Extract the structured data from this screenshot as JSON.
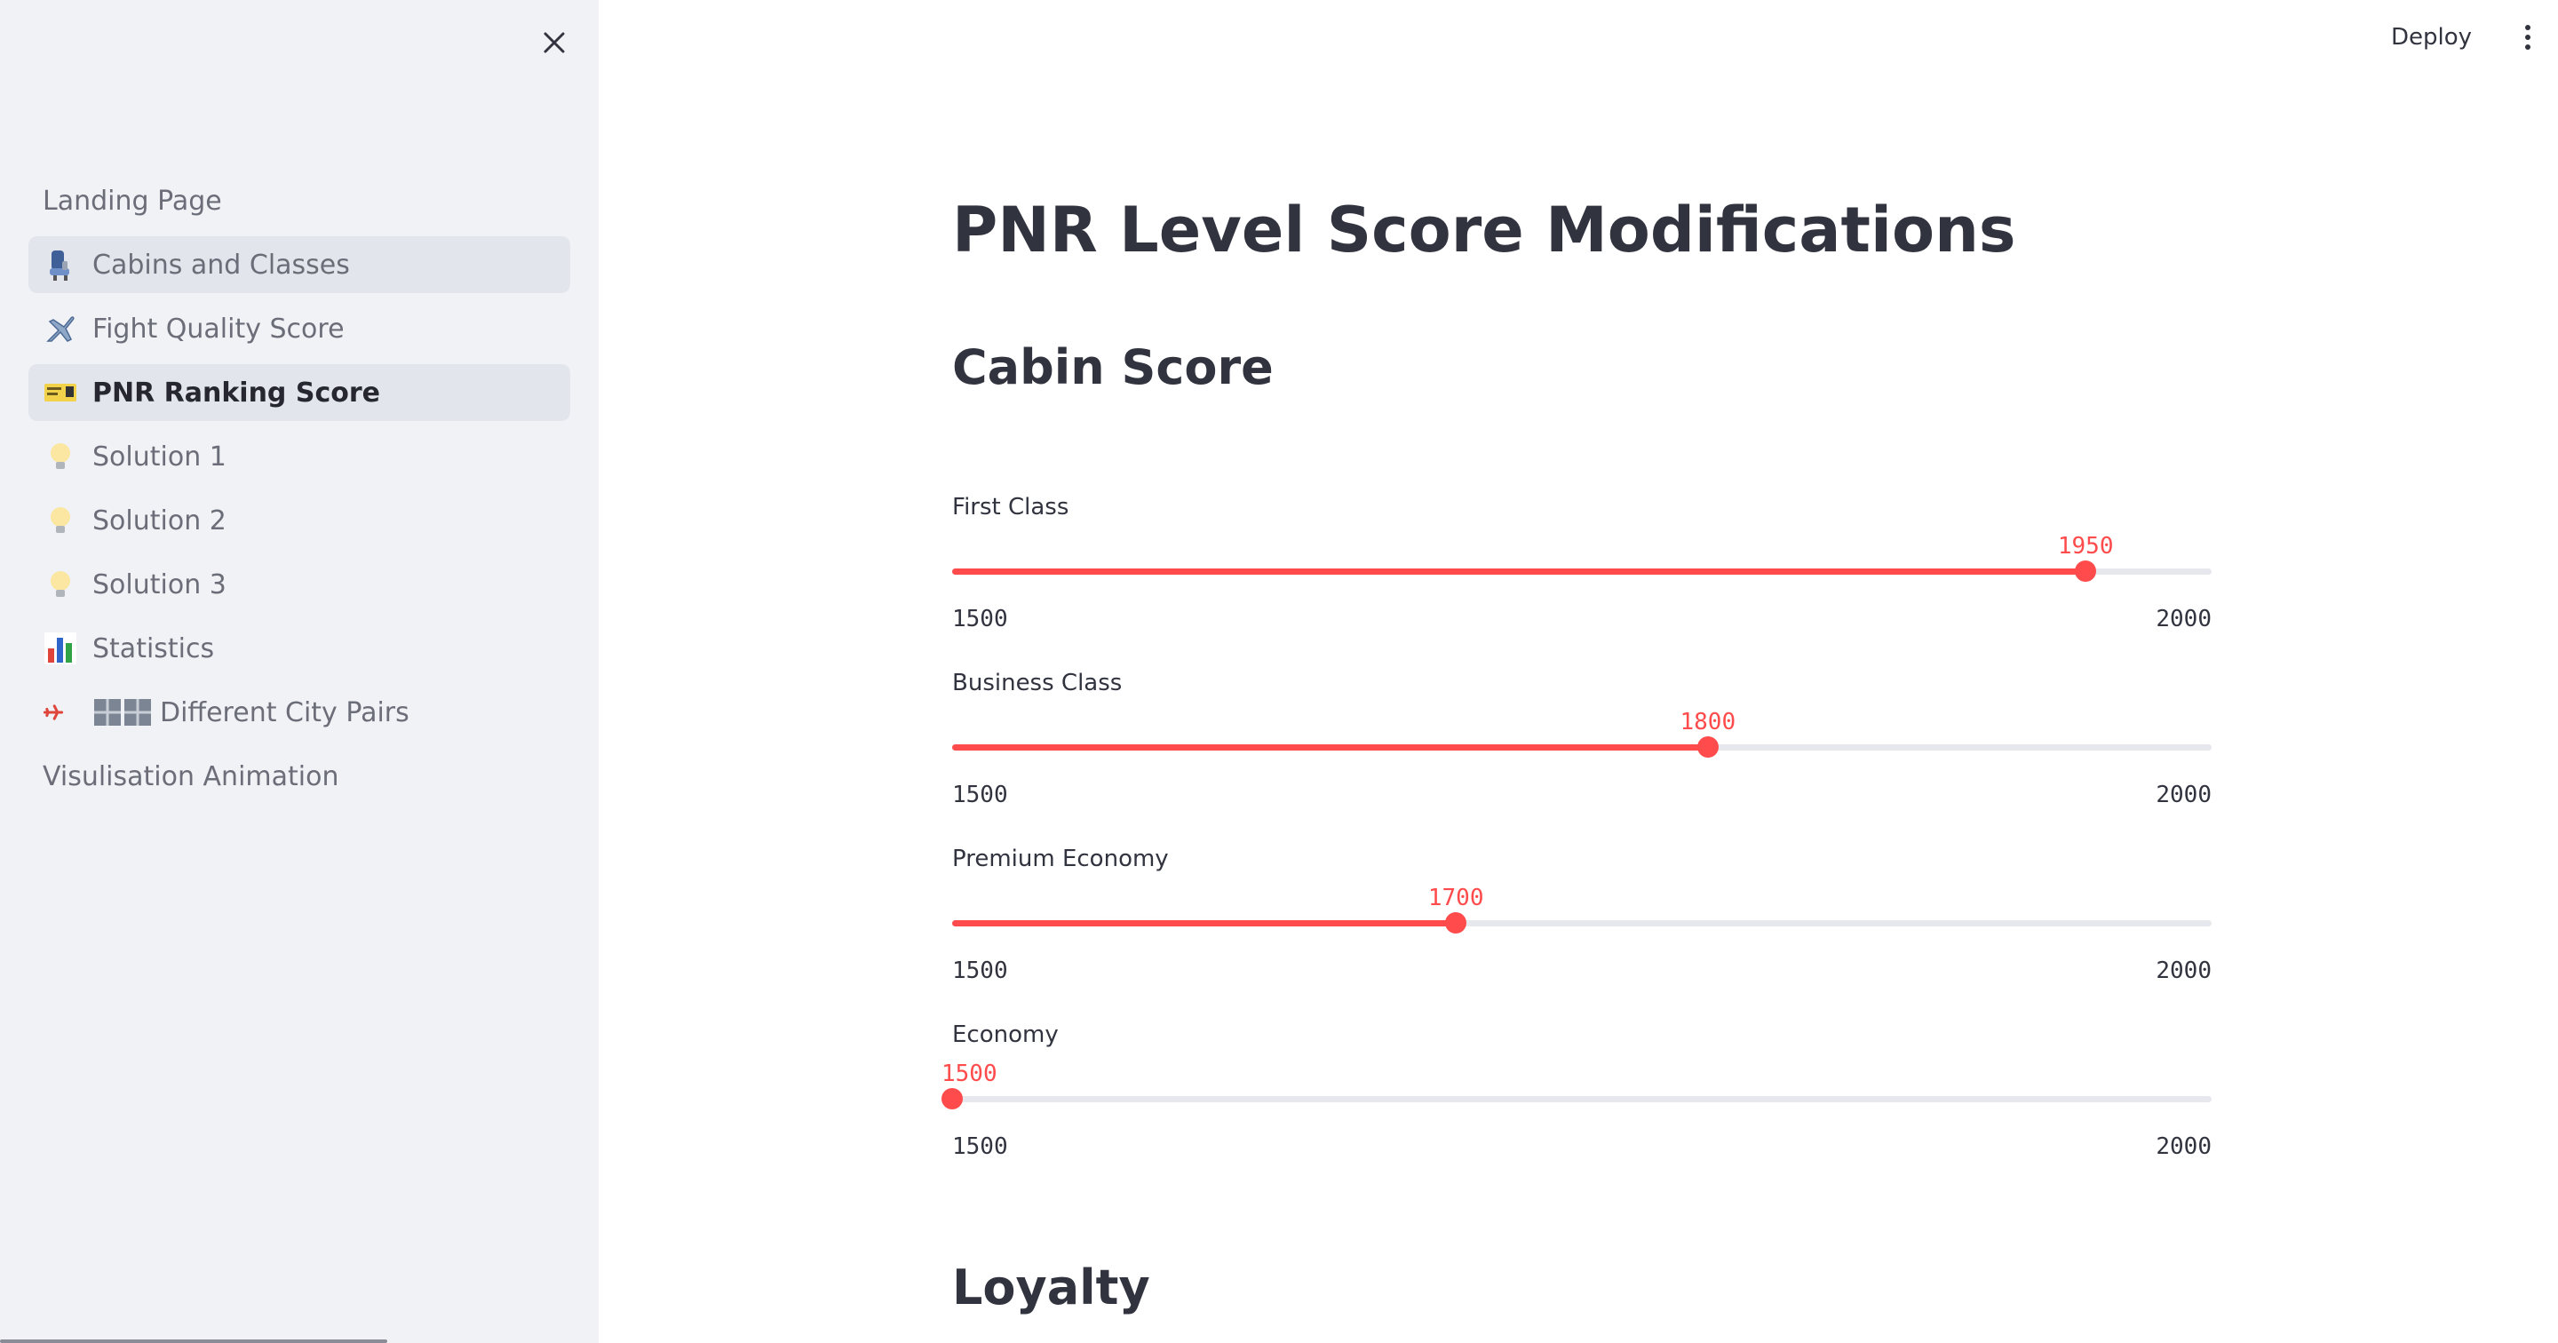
{
  "header": {
    "deploy_label": "Deploy",
    "menu_icon": "kebab-menu-icon"
  },
  "sidebar": {
    "close_icon": "close-icon",
    "items": [
      {
        "label": "Landing Page",
        "icon": ""
      },
      {
        "label": "Cabins and Classes",
        "icon": "seat-icon"
      },
      {
        "label": "Fight Quality Score",
        "icon": "airplane-icon"
      },
      {
        "label": "PNR Ranking Score",
        "icon": "ticket-icon"
      },
      {
        "label": "Solution 1",
        "icon": "lightbulb-icon"
      },
      {
        "label": "Solution 2",
        "icon": "lightbulb-icon"
      },
      {
        "label": "Solution 3",
        "icon": "lightbulb-icon"
      },
      {
        "label": "Statistics",
        "icon": "bar-chart-icon"
      },
      {
        "label": "Different City Pairs",
        "icon": "plane-buildings-icon"
      },
      {
        "label": "Visulisation Animation",
        "icon": ""
      }
    ],
    "active_index": 3
  },
  "main": {
    "title": "PNR Level Score Modifications",
    "sections": [
      "Cabin Score",
      "Loyalty"
    ],
    "sliders": [
      {
        "label": "First Class",
        "value": 1950,
        "min": 1500,
        "max": 2000
      },
      {
        "label": "Business Class",
        "value": 1800,
        "min": 1500,
        "max": 2000
      },
      {
        "label": "Premium Economy",
        "value": 1700,
        "min": 1500,
        "max": 2000
      },
      {
        "label": "Economy",
        "value": 1500,
        "min": 1500,
        "max": 2000
      }
    ]
  },
  "colors": {
    "accent": "#ff4b4b",
    "sidebar_bg": "#f0f2f6",
    "text": "#31333f"
  }
}
